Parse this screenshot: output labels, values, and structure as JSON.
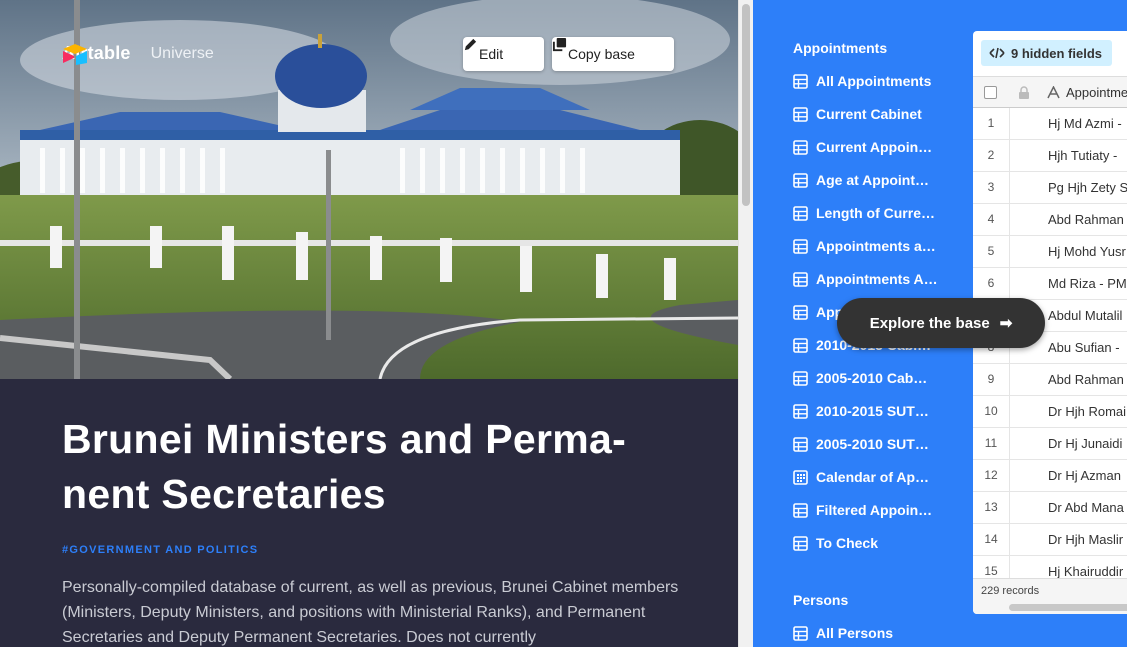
{
  "brand": {
    "name": "Airtable",
    "sub": "Universe"
  },
  "hero_buttons": {
    "edit": "Edit",
    "copy": "Copy base"
  },
  "base": {
    "title": "Brunei Ministers and Perma-nent Secretaries",
    "tag": "#GOVERNMENT AND POLITICS",
    "description": "Personally-compiled database of current, as well as previous, Brunei Cabinet members (Ministers, Deputy Ministers, and positions with Ministerial Ranks), and Permanent Secretaries and Deputy Permanent Secretaries. Does not currently"
  },
  "sidebar": {
    "appointments_heading": "Appointments",
    "items": [
      {
        "label": "All Appointments",
        "icon": "grid-icon"
      },
      {
        "label": "Current Cabinet",
        "icon": "grid-icon"
      },
      {
        "label": "Current Appoin…",
        "icon": "grid-icon"
      },
      {
        "label": "Age at Appoint…",
        "icon": "grid-icon"
      },
      {
        "label": "Length of Curre…",
        "icon": "grid-icon"
      },
      {
        "label": "Appointments a…",
        "icon": "grid-icon"
      },
      {
        "label": "Appointments A…",
        "icon": "grid-icon"
      },
      {
        "label": "App",
        "icon": "grid-icon"
      },
      {
        "label": "2010-2015 Cabi…",
        "icon": "grid-icon"
      },
      {
        "label": "2005-2010 Cab…",
        "icon": "grid-icon"
      },
      {
        "label": "2010-2015 SUT…",
        "icon": "grid-icon"
      },
      {
        "label": "2005-2010 SUT…",
        "icon": "grid-icon"
      },
      {
        "label": "Calendar of Ap…",
        "icon": "calendar-icon"
      },
      {
        "label": "Filtered Appoin…",
        "icon": "grid-icon"
      },
      {
        "label": "To Check",
        "icon": "grid-icon"
      }
    ],
    "persons_heading": "Persons",
    "persons_items": [
      {
        "label": "All Persons",
        "icon": "grid-icon"
      }
    ]
  },
  "grid": {
    "hidden_fields": "9 hidden fields",
    "column": "Appointme",
    "rows": [
      {
        "num": "1",
        "value": "Hj Md Azmi -"
      },
      {
        "num": "2",
        "value": "Hjh Tutiaty -"
      },
      {
        "num": "3",
        "value": "Pg Hjh Zety S"
      },
      {
        "num": "4",
        "value": "Abd Rahman"
      },
      {
        "num": "5",
        "value": "Hj Mohd Yusr"
      },
      {
        "num": "6",
        "value": "Md Riza - PM"
      },
      {
        "num": "7",
        "value": "Abdul Mutalil"
      },
      {
        "num": "8",
        "value": "Abu Sufian -"
      },
      {
        "num": "9",
        "value": "Abd Rahman"
      },
      {
        "num": "10",
        "value": "Dr Hjh Romai"
      },
      {
        "num": "11",
        "value": "Dr Hj Junaidi"
      },
      {
        "num": "12",
        "value": "Dr Hj Azman"
      },
      {
        "num": "13",
        "value": "Dr Abd Mana"
      },
      {
        "num": "14",
        "value": "Dr Hjh Maslir"
      },
      {
        "num": "15",
        "value": "Hj Khairuddir"
      }
    ],
    "records": "229 records"
  },
  "explore": {
    "label": "Explore the base",
    "arrow": "➡"
  },
  "colors": {
    "accent": "#2d7ff9",
    "dark_panel": "#2a2a3e",
    "tag": "#2d7ff9"
  }
}
